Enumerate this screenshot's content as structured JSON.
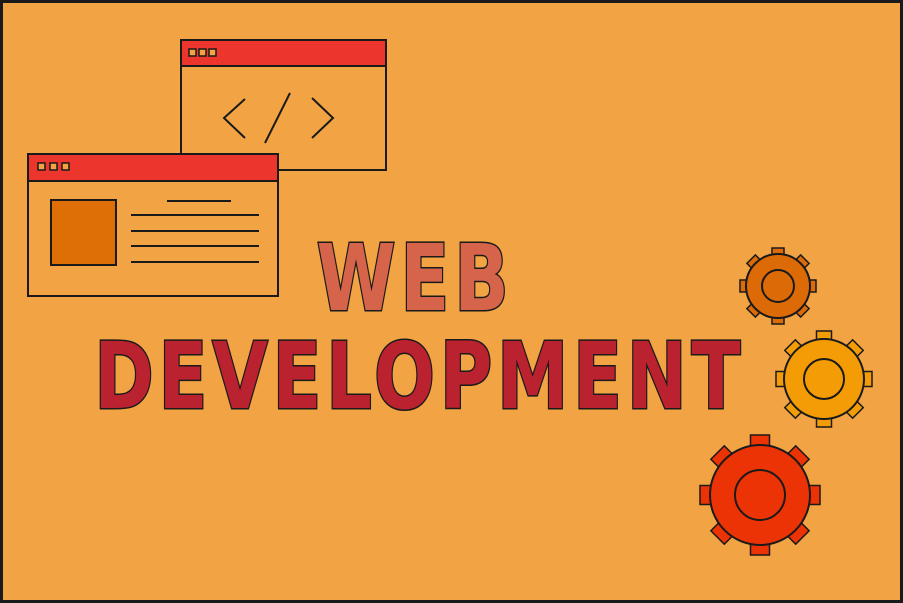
{
  "title": {
    "line1": "WEB",
    "line2": "DEVELOPMENT"
  },
  "colors": {
    "background": "#F2A444",
    "outline": "#1A1A1A",
    "window_titlebar": "#EC352C",
    "window_body": "#F2A444",
    "image_placeholder": "#DE6F06",
    "title_line1": "#D6644A",
    "title_line2": "#B9222E",
    "gear_small": "#DC6A06",
    "gear_medium": "#F39C06",
    "gear_large": "#EC3306"
  },
  "icons": [
    "code-window-icon",
    "webpage-window-icon",
    "code-brackets-icon",
    "gear-icon"
  ]
}
